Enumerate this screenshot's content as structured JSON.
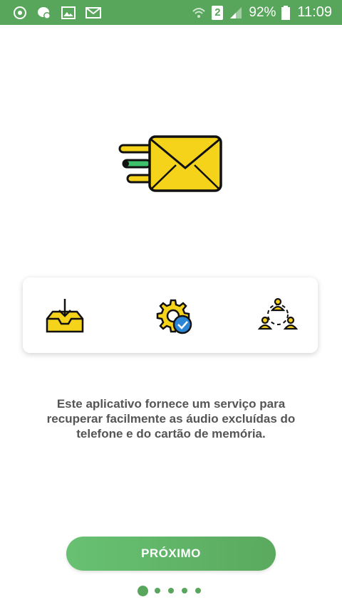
{
  "status_bar": {
    "battery": "92%",
    "time": "11:09",
    "sim_slot": "2",
    "left_icons": [
      "sync-icon",
      "chat-bubble-icon",
      "image-icon",
      "mail-icon"
    ],
    "right_icons": [
      "wifi-icon",
      "sim-badge",
      "signal-icon",
      "battery-icon"
    ]
  },
  "hero": {
    "icon": "flying-envelope-icon"
  },
  "features": [
    {
      "icon": "inbox-download-icon"
    },
    {
      "icon": "settings-check-icon"
    },
    {
      "icon": "group-share-icon"
    }
  ],
  "description": {
    "text": "Este aplicativo fornece um serviço para recuperar facilmente as áudio excluídas do telefone e do cartão de memória."
  },
  "next_button": {
    "label": "PRÓXIMO"
  },
  "pager": {
    "pages": 5,
    "current": 1
  },
  "colors": {
    "primary_green": "#58a55c",
    "button_green": "#68c173",
    "accent_yellow": "#f5d31a",
    "accent_blue": "#2c86d6",
    "text_gray": "#555555"
  }
}
